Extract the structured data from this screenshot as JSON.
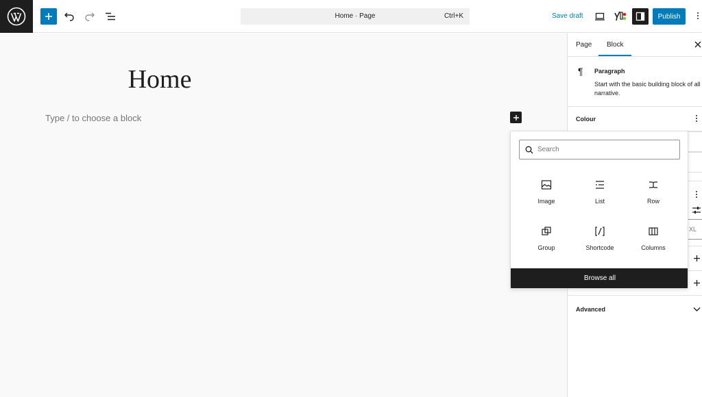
{
  "topbar": {
    "document_title": "Home · Page",
    "shortcut": "Ctrl+K",
    "save_draft": "Save draft",
    "publish": "Publish"
  },
  "canvas": {
    "heading": "Home",
    "placeholder": "Type / to choose a block"
  },
  "inserter": {
    "search_placeholder": "Search",
    "items": [
      {
        "label": "Image",
        "icon": "image-icon"
      },
      {
        "label": "List",
        "icon": "list-icon"
      },
      {
        "label": "Row",
        "icon": "row-icon"
      },
      {
        "label": "Group",
        "icon": "group-icon"
      },
      {
        "label": "Shortcode",
        "icon": "shortcode-icon"
      },
      {
        "label": "Columns",
        "icon": "columns-icon"
      }
    ],
    "browse_all": "Browse all"
  },
  "sidebar": {
    "tabs": [
      {
        "label": "Page"
      },
      {
        "label": "Block",
        "active": true
      }
    ],
    "block": {
      "name": "Paragraph",
      "description": "Start with the basic building block of all narrative."
    },
    "sections": {
      "colour": "Colour",
      "size_partial": "XL",
      "advanced": "Advanced"
    }
  },
  "colors": {
    "accent": "#007cba",
    "dark": "#1e1e1e"
  }
}
